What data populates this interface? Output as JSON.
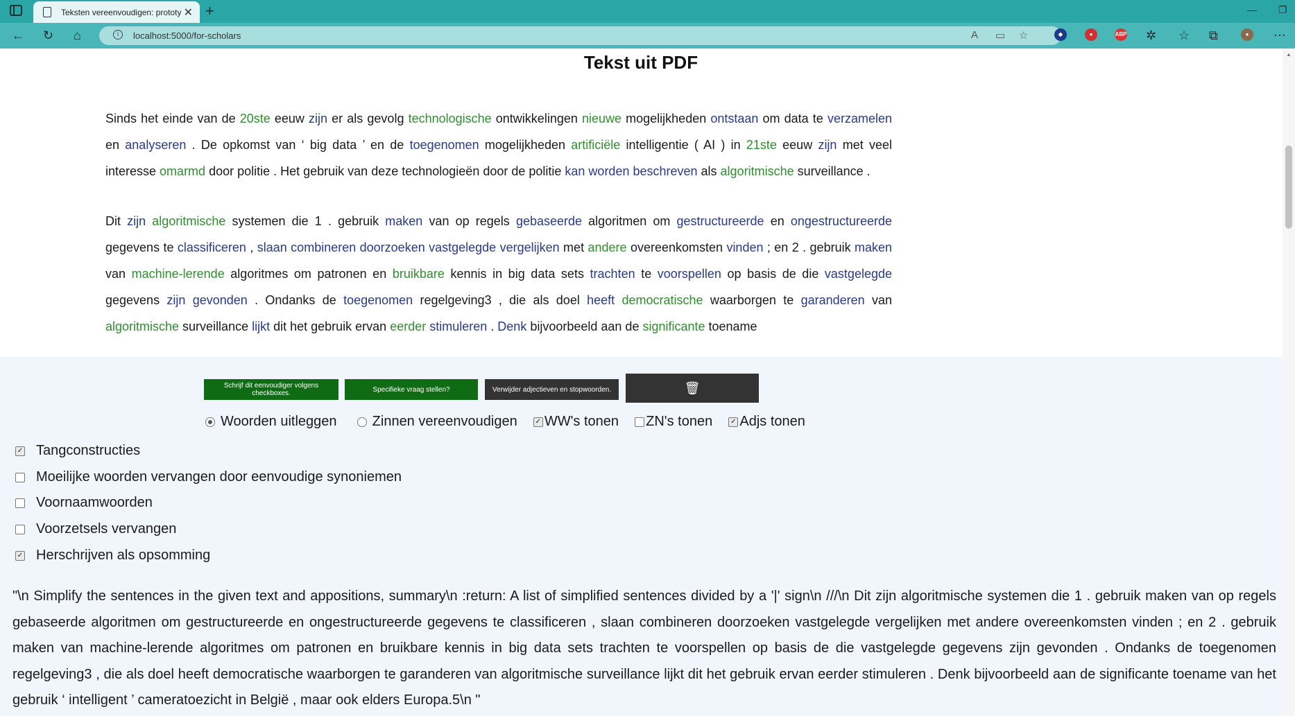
{
  "browser": {
    "tab_title": "Teksten vereenvoudigen: prototy",
    "url": "localhost:5000/for-scholars"
  },
  "page": {
    "title": "Tekst uit PDF",
    "paragraphs": [
      [
        {
          "t": "Sinds het einde van de ",
          "c": ""
        },
        {
          "t": "20ste",
          "c": "a"
        },
        {
          "t": " eeuw ",
          "c": ""
        },
        {
          "t": "zijn",
          "c": "v"
        },
        {
          "t": " er als gevolg ",
          "c": ""
        },
        {
          "t": "technologische",
          "c": "a"
        },
        {
          "t": " ontwikkelingen ",
          "c": ""
        },
        {
          "t": "nieuwe",
          "c": "a"
        },
        {
          "t": " mogelijkheden ",
          "c": ""
        },
        {
          "t": "ontstaan",
          "c": "v"
        },
        {
          "t": " om data te ",
          "c": ""
        },
        {
          "t": "verzamelen",
          "c": "v"
        },
        {
          "t": " en ",
          "c": ""
        },
        {
          "t": "analyseren",
          "c": "v"
        },
        {
          "t": " . De opkomst van ‘ big data ’ en de ",
          "c": ""
        },
        {
          "t": "toegenomen",
          "c": "v"
        },
        {
          "t": " mogelijkheden ",
          "c": ""
        },
        {
          "t": "artificiële",
          "c": "a"
        },
        {
          "t": " intelligentie ( AI ) in ",
          "c": ""
        },
        {
          "t": "21ste",
          "c": "a"
        },
        {
          "t": " eeuw ",
          "c": ""
        },
        {
          "t": "zijn",
          "c": "v"
        },
        {
          "t": " met veel interesse ",
          "c": ""
        },
        {
          "t": "omarmd",
          "c": "a"
        },
        {
          "t": " door politie . Het gebruik van deze technologieën door de politie ",
          "c": ""
        },
        {
          "t": "kan worden beschreven",
          "c": "v"
        },
        {
          "t": " als ",
          "c": ""
        },
        {
          "t": "algoritmische",
          "c": "a"
        },
        {
          "t": " surveillance .",
          "c": ""
        }
      ],
      [
        {
          "t": "Dit ",
          "c": ""
        },
        {
          "t": "zijn",
          "c": "v"
        },
        {
          "t": " ",
          "c": ""
        },
        {
          "t": "algoritmische",
          "c": "a"
        },
        {
          "t": " systemen die 1 . gebruik ",
          "c": ""
        },
        {
          "t": "maken",
          "c": "v"
        },
        {
          "t": " van op regels ",
          "c": ""
        },
        {
          "t": "gebaseerde",
          "c": "v"
        },
        {
          "t": " algoritmen om ",
          "c": ""
        },
        {
          "t": "gestructureerde",
          "c": "v"
        },
        {
          "t": " en ",
          "c": ""
        },
        {
          "t": "ongestructureerde",
          "c": "v"
        },
        {
          "t": " gegevens te ",
          "c": ""
        },
        {
          "t": "classificeren",
          "c": "v"
        },
        {
          "t": " , ",
          "c": ""
        },
        {
          "t": "slaan combineren doorzoeken vastgelegde vergelijken",
          "c": "v"
        },
        {
          "t": " met ",
          "c": ""
        },
        {
          "t": "andere",
          "c": "a"
        },
        {
          "t": " overeenkomsten ",
          "c": ""
        },
        {
          "t": "vinden",
          "c": "v"
        },
        {
          "t": " ; en 2 . gebruik ",
          "c": ""
        },
        {
          "t": "maken",
          "c": "v"
        },
        {
          "t": " van ",
          "c": ""
        },
        {
          "t": "machine-lerende",
          "c": "a"
        },
        {
          "t": " algoritmes om patronen en ",
          "c": ""
        },
        {
          "t": "bruikbare",
          "c": "a"
        },
        {
          "t": " kennis in big data sets ",
          "c": ""
        },
        {
          "t": "trachten",
          "c": "v"
        },
        {
          "t": " te ",
          "c": ""
        },
        {
          "t": "voorspellen",
          "c": "v"
        },
        {
          "t": " op basis de die ",
          "c": ""
        },
        {
          "t": "vastgelegde",
          "c": "v"
        },
        {
          "t": " gegevens ",
          "c": ""
        },
        {
          "t": "zijn gevonden",
          "c": "v"
        },
        {
          "t": " . Ondanks de ",
          "c": ""
        },
        {
          "t": "toegenomen",
          "c": "v"
        },
        {
          "t": " regelgeving3 , die als doel ",
          "c": ""
        },
        {
          "t": "heeft",
          "c": "v"
        },
        {
          "t": " ",
          "c": ""
        },
        {
          "t": "democratische",
          "c": "a"
        },
        {
          "t": " waarborgen te ",
          "c": ""
        },
        {
          "t": "garanderen",
          "c": "v"
        },
        {
          "t": " van ",
          "c": ""
        },
        {
          "t": "algoritmische",
          "c": "a"
        },
        {
          "t": " surveillance ",
          "c": ""
        },
        {
          "t": "lijkt",
          "c": "v"
        },
        {
          "t": " dit het gebruik ervan ",
          "c": ""
        },
        {
          "t": "eerder",
          "c": "a"
        },
        {
          "t": " ",
          "c": ""
        },
        {
          "t": "stimuleren",
          "c": "v"
        },
        {
          "t": " . ",
          "c": ""
        },
        {
          "t": "Denk",
          "c": "v"
        },
        {
          "t": " bijvoorbeeld aan de ",
          "c": ""
        },
        {
          "t": "significante",
          "c": "a"
        },
        {
          "t": " toename",
          "c": ""
        }
      ]
    ]
  },
  "buttons": {
    "simplify": "Schrijf dit eenvoudiger volgens checkboxes.",
    "question": "Specifieke vraag stellen?",
    "remove": "Verwijder adjectieven en stopwoorden."
  },
  "options": {
    "radio_explain": "Woorden uitleggen",
    "radio_simplify": "Zinnen vereenvoudigen",
    "show_verbs": "WW's tonen",
    "show_nouns": "ZN's tonen",
    "show_adjs": "Adjs tonen"
  },
  "checkboxes": [
    {
      "label": "Tangconstructies",
      "checked": true
    },
    {
      "label": "Moeilijke woorden vervangen door eenvoudige synoniemen",
      "checked": false
    },
    {
      "label": "Voornaamwoorden",
      "checked": false
    },
    {
      "label": "Voorzetsels vervangen",
      "checked": false
    },
    {
      "label": "Herschrijven als opsomming",
      "checked": true
    }
  ],
  "output": "\"\\n Simplify the sentences in the given text and appositions, summary\\n :return: A list of simplified sentences divided by a '|' sign\\n ///\\n Dit zijn algoritmische systemen die 1 . gebruik maken van op regels gebaseerde algoritmen om gestructureerde en ongestructureerde gegevens te classificeren , slaan combineren doorzoeken vastgelegde vergelijken met andere overeenkomsten vinden ; en 2 . gebruik maken van machine-lerende algoritmes om patronen en bruikbare kennis in big data sets trachten te voorspellen op basis de die vastgelegde gegevens zijn gevonden . Ondanks de toegenomen regelgeving3 , die als doel heeft democratische waarborgen te garanderen van algoritmische surveillance lijkt dit het gebruik ervan eerder stimuleren . Denk bijvoorbeeld aan de significante toename van het gebruik ‘ intelligent ’ cameratoezicht in België , maar ook elders Europa.5\\n \"",
  "colors": {
    "verb": "#2a3a8a",
    "adjective": "#2f8f2f",
    "tab_bar": "#2aa6a6",
    "button_green": "#0f6b14"
  },
  "icons": [
    "tab-actions-icon",
    "page-icon",
    "close-icon",
    "plus-icon",
    "back-icon",
    "refresh-icon",
    "home-icon",
    "info-icon",
    "read-aloud-icon",
    "favorites-icon",
    "extensions-icon",
    "collections-icon",
    "trash-icon"
  ]
}
